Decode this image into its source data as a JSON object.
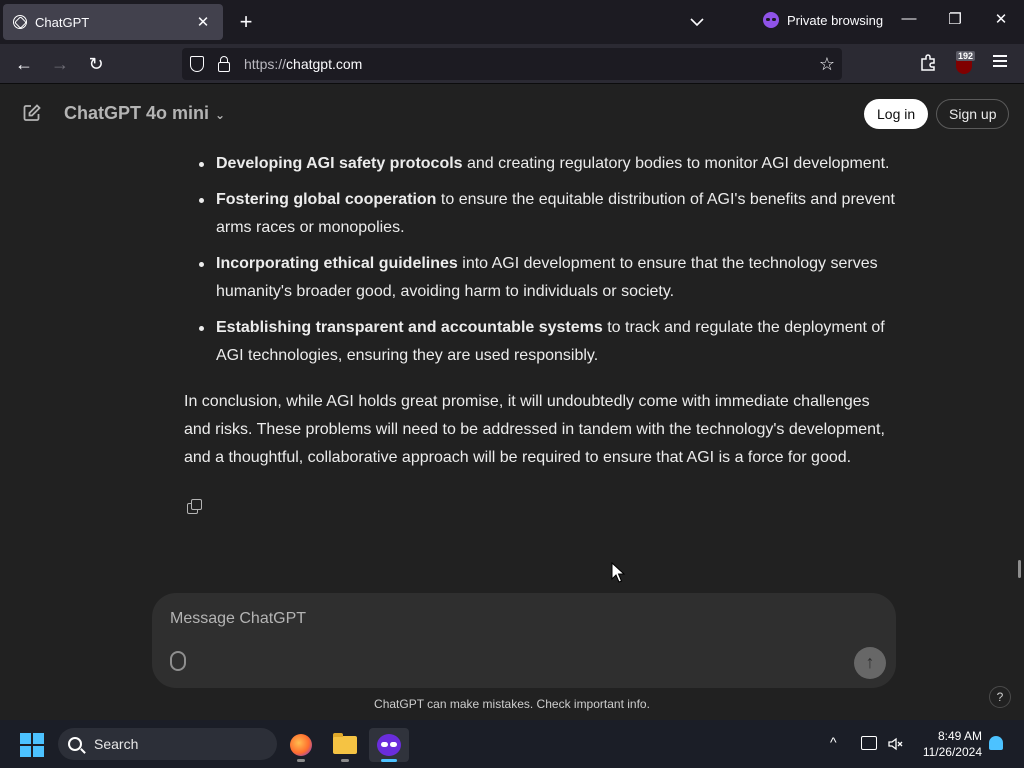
{
  "browser": {
    "tab": {
      "title": "ChatGPT",
      "close": "✕"
    },
    "new_tab": "+",
    "tab_list": "⌄",
    "private_label": "Private browsing",
    "window": {
      "minimize": "—",
      "maximize": "❐",
      "close": "✕"
    },
    "nav": {
      "back": "←",
      "forward": "→",
      "reload": "↻"
    },
    "url": {
      "protocol": "https://",
      "host": "chatgpt.com"
    },
    "bookmark": "☆",
    "ublock_count": "192"
  },
  "header": {
    "model_name": "ChatGPT 4o mini",
    "model_chevron": "⌄",
    "login_label": "Log in",
    "signup_label": "Sign up"
  },
  "message": {
    "bullets": [
      {
        "bold": "Developing AGI safety protocols",
        "rest": " and creating regulatory bodies to monitor AGI development."
      },
      {
        "bold": "Fostering global cooperation",
        "rest": " to ensure the equitable distribution of AGI's benefits and prevent arms races or monopolies."
      },
      {
        "bold": "Incorporating ethical guidelines",
        "rest": " into AGI development to ensure that the technology serves humanity's broader good, avoiding harm to individuals or society."
      },
      {
        "bold": "Establishing transparent and accountable systems",
        "rest": " to track and regulate the deployment of AGI technologies, ensuring they are used responsibly."
      }
    ],
    "conclusion": "In conclusion, while AGI holds great promise, it will undoubtedly come with immediate challenges and risks. These problems will need to be addressed in tandem with the technology's development, and a thoughtful, collaborative approach will be required to ensure that AGI is a force for good."
  },
  "composer": {
    "placeholder": "Message ChatGPT",
    "send": "↑"
  },
  "disclaimer": "ChatGPT can make mistakes. Check important info.",
  "help": "?",
  "taskbar": {
    "search_label": "Search",
    "tray_chevron": "^",
    "time": "8:49 AM",
    "date": "11/26/2024"
  },
  "colors": {
    "page_bg": "#212121",
    "composer_bg": "#2f2f2f",
    "accent_windows": "#4cc2ff",
    "private_purple": "#8f53e8"
  }
}
